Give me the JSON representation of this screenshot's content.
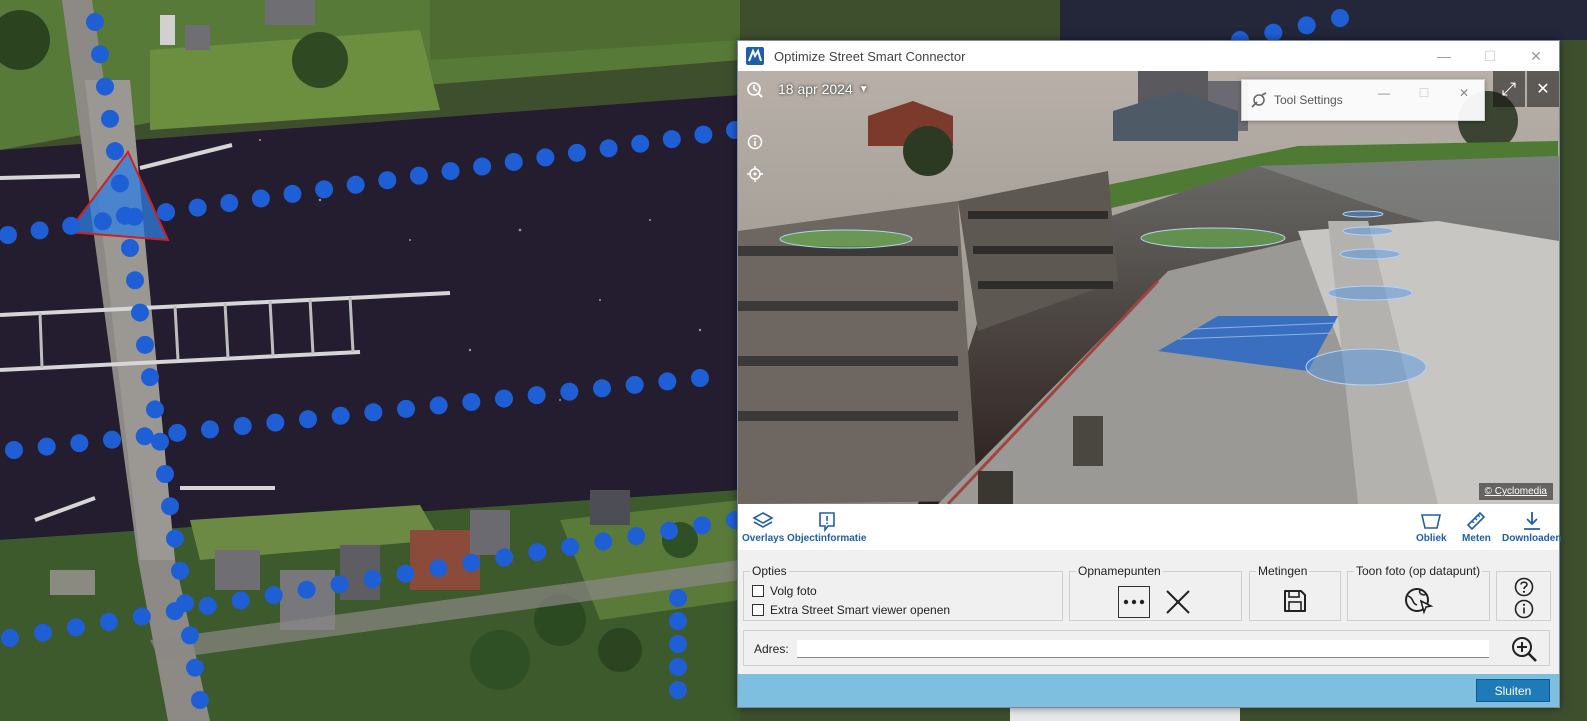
{
  "window": {
    "title": "Optimize Street Smart Connector",
    "minimize_glyph": "—",
    "maximize_glyph": "☐",
    "close_glyph": "✕"
  },
  "viewer": {
    "date": "18 apr 2024",
    "copyright": "© Cyclomedia",
    "expand_glyph": "⤢",
    "close_glyph": "✕"
  },
  "tool_settings": {
    "title": "Tool Settings",
    "minimize_glyph": "—",
    "maximize_glyph": "☐",
    "close_glyph": "✕"
  },
  "toolbar": {
    "left": [
      {
        "label": "Overlays",
        "icon": "layers-icon"
      },
      {
        "label": "Objectinformatie",
        "icon": "object-info-icon"
      }
    ],
    "right": [
      {
        "label": "Obliek",
        "icon": "oblique-icon"
      },
      {
        "label": "Meten",
        "icon": "ruler-icon"
      },
      {
        "label": "Downloaden",
        "icon": "download-icon"
      }
    ]
  },
  "options": {
    "legend": "Opties",
    "volg_foto": "Volg foto",
    "extra_viewer": "Extra Street Smart viewer openen"
  },
  "opnamepunten": {
    "legend": "Opnamepunten"
  },
  "metingen": {
    "legend": "Metingen"
  },
  "toon_foto": {
    "legend": "Toon foto (op datapunt)"
  },
  "address": {
    "label": "Adres:",
    "value": "",
    "placeholder": ""
  },
  "footer": {
    "close_label": "Sluiten"
  },
  "colors": {
    "accent": "#1f5ea8",
    "footer": "#7ebedf",
    "close_button": "#1f7ab8",
    "recording_dot": "#1f5fd6"
  }
}
